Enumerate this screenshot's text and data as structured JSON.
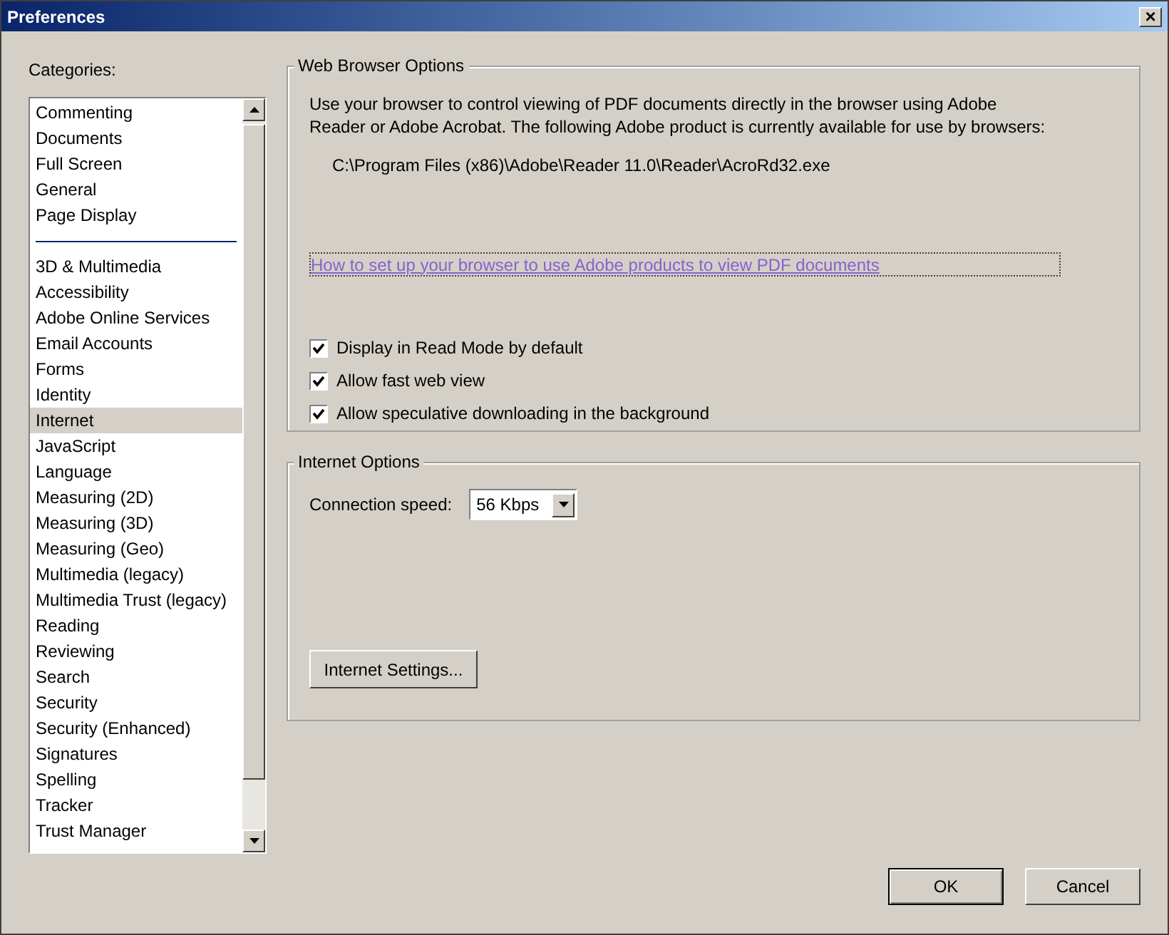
{
  "window": {
    "title": "Preferences",
    "close": "×"
  },
  "categories": {
    "label": "Categories:",
    "items": [
      {
        "kind": "item",
        "label": "Commenting",
        "selected": false
      },
      {
        "kind": "item",
        "label": "Documents",
        "selected": false
      },
      {
        "kind": "item",
        "label": "Full Screen",
        "selected": false
      },
      {
        "kind": "item",
        "label": "General",
        "selected": false
      },
      {
        "kind": "item",
        "label": "Page Display",
        "selected": false
      },
      {
        "kind": "separator"
      },
      {
        "kind": "item",
        "label": "3D & Multimedia",
        "selected": false
      },
      {
        "kind": "item",
        "label": "Accessibility",
        "selected": false
      },
      {
        "kind": "item",
        "label": "Adobe Online Services",
        "selected": false
      },
      {
        "kind": "item",
        "label": "Email Accounts",
        "selected": false
      },
      {
        "kind": "item",
        "label": "Forms",
        "selected": false
      },
      {
        "kind": "item",
        "label": "Identity",
        "selected": false
      },
      {
        "kind": "item",
        "label": "Internet",
        "selected": true
      },
      {
        "kind": "item",
        "label": "JavaScript",
        "selected": false
      },
      {
        "kind": "item",
        "label": "Language",
        "selected": false
      },
      {
        "kind": "item",
        "label": "Measuring (2D)",
        "selected": false
      },
      {
        "kind": "item",
        "label": "Measuring (3D)",
        "selected": false
      },
      {
        "kind": "item",
        "label": "Measuring (Geo)",
        "selected": false
      },
      {
        "kind": "item",
        "label": "Multimedia (legacy)",
        "selected": false
      },
      {
        "kind": "item",
        "label": "Multimedia Trust (legacy)",
        "selected": false
      },
      {
        "kind": "item",
        "label": "Reading",
        "selected": false
      },
      {
        "kind": "item",
        "label": "Reviewing",
        "selected": false
      },
      {
        "kind": "item",
        "label": "Search",
        "selected": false
      },
      {
        "kind": "item",
        "label": "Security",
        "selected": false
      },
      {
        "kind": "item",
        "label": "Security (Enhanced)",
        "selected": false
      },
      {
        "kind": "item",
        "label": "Signatures",
        "selected": false
      },
      {
        "kind": "item",
        "label": "Spelling",
        "selected": false
      },
      {
        "kind": "item",
        "label": "Tracker",
        "selected": false
      },
      {
        "kind": "item",
        "label": "Trust Manager",
        "selected": false
      }
    ]
  },
  "web_browser_options": {
    "title": "Web Browser Options",
    "description": "Use your browser to control viewing of PDF documents directly in the browser using Adobe Reader or Adobe Acrobat. The following Adobe product is currently available for use by browsers:",
    "path": "C:\\Program Files (x86)\\Adobe\\Reader 11.0\\Reader\\AcroRd32.exe",
    "link": "How to set up your browser to use Adobe products to view PDF documents",
    "checkboxes": [
      {
        "label": "Display in Read Mode by default",
        "checked": true
      },
      {
        "label": "Allow fast web view",
        "checked": true
      },
      {
        "label": "Allow speculative downloading in the background",
        "checked": true
      }
    ]
  },
  "internet_options": {
    "title": "Internet Options",
    "speed_label": "Connection speed:",
    "speed_value": "56 Kbps",
    "settings_button": "Internet Settings..."
  },
  "buttons": [
    "OK",
    "Cancel"
  ]
}
